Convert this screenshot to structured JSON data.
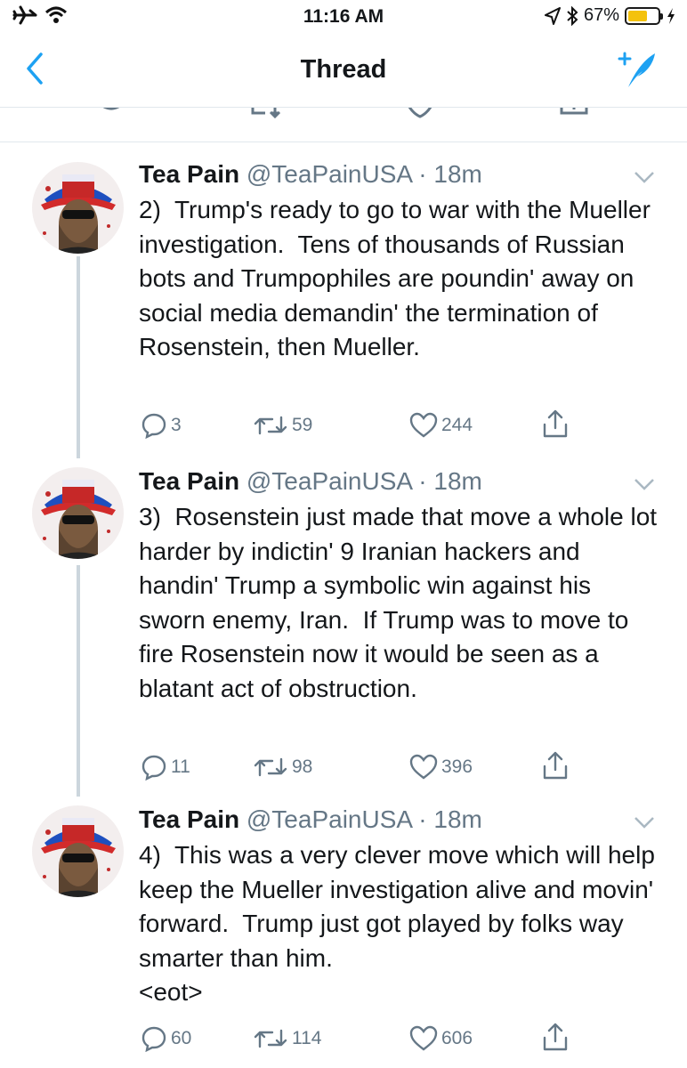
{
  "status_bar": {
    "time": "11:16 AM",
    "battery": "67%",
    "battery_level": 0.67
  },
  "nav": {
    "title": "Thread"
  },
  "tweets": [
    {
      "name": "Tea Pain",
      "handle": "@TeaPainUSA",
      "time": "18m",
      "text": "2)  Trump's ready to go to war with the Mueller investigation.  Tens of thousands of Russian bots and Trumpophiles are poundin' away on social media demandin' the termination of Rosenstein, then Mueller.",
      "replies": "3",
      "retweets": "59",
      "likes": "244"
    },
    {
      "name": "Tea Pain",
      "handle": "@TeaPainUSA",
      "time": "18m",
      "text": "3)  Rosenstein just made that move a whole lot harder by indictin' 9 Iranian hackers and handin' Trump a symbolic win against his sworn enemy, Iran.  If Trump was to move to fire Rosenstein now it would be seen as a blatant act of obstruction.",
      "replies": "11",
      "retweets": "98",
      "likes": "396"
    },
    {
      "name": "Tea Pain",
      "handle": "@TeaPainUSA",
      "time": "18m",
      "text": "4)  This was a very clever move which will help keep the Mueller investigation alive and movin' forward.  Trump just got played by folks way smarter than him.\n<eot>",
      "replies": "60",
      "retweets": "114",
      "likes": "606"
    }
  ],
  "colors": {
    "accent": "#1da1f2",
    "secondary_text": "#657786",
    "divider": "#e1e8ed",
    "thread_line": "#ccd6dd"
  },
  "icons": [
    "airplane-icon",
    "wifi-icon",
    "location-icon",
    "bluetooth-icon",
    "battery-icon",
    "charging-icon",
    "back-icon",
    "compose-icon",
    "reply-icon",
    "retweet-icon",
    "like-icon",
    "share-icon",
    "chevron-down-icon"
  ]
}
